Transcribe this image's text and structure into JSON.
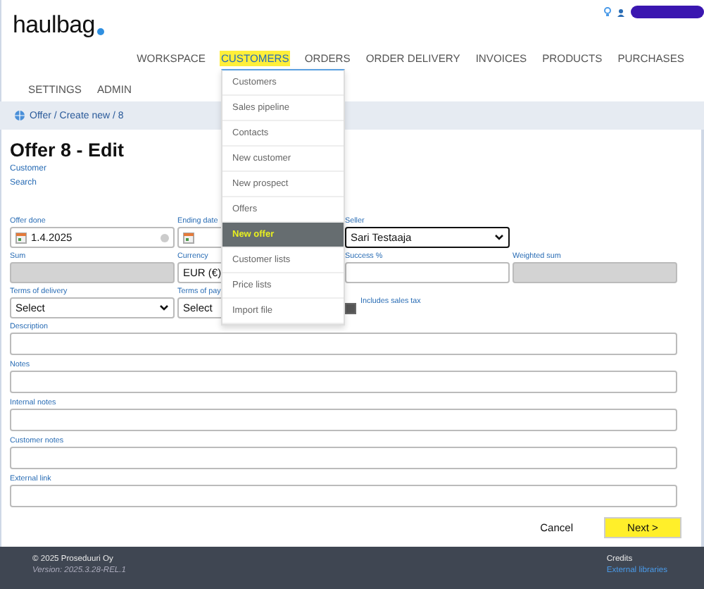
{
  "logo": {
    "text": "haulbag"
  },
  "nav": [
    {
      "label": "WORKSPACE",
      "selected": false
    },
    {
      "label": "CUSTOMERS",
      "selected": true
    },
    {
      "label": "ORDERS",
      "selected": false
    },
    {
      "label": "ORDER DELIVERY",
      "selected": false
    },
    {
      "label": "INVOICES",
      "selected": false
    },
    {
      "label": "PRODUCTS",
      "selected": false
    },
    {
      "label": "PURCHASES",
      "selected": false
    },
    {
      "label": "SETTINGS",
      "selected": false
    },
    {
      "label": "ADMIN",
      "selected": false
    }
  ],
  "menu": [
    {
      "label": "Customers",
      "selected": false
    },
    {
      "label": "Sales pipeline",
      "selected": false
    },
    {
      "label": "Contacts",
      "selected": false
    },
    {
      "label": "New customer",
      "selected": false
    },
    {
      "label": "New prospect",
      "selected": false
    },
    {
      "label": "Offers",
      "selected": false
    },
    {
      "label": "New offer",
      "selected": true
    },
    {
      "label": "Customer lists",
      "selected": false
    },
    {
      "label": "Price lists",
      "selected": false
    },
    {
      "label": "Import file",
      "selected": false
    }
  ],
  "breadcrumb": "Offer / Create new / 8",
  "title": "Offer 8 - Edit",
  "customer": {
    "label": "Customer",
    "link": "Search"
  },
  "fields": [
    {
      "kind": "date",
      "label": "Offer done",
      "value": "1.4.2025"
    },
    {
      "kind": "date",
      "label": "Ending date"
    },
    {
      "kind": "select",
      "label": "Seller",
      "value": "Sari Testaaja"
    },
    {
      "kind": "empty"
    },
    {
      "kind": "readonly",
      "label": "Sum"
    },
    {
      "kind": "text",
      "label": "Currency",
      "value": "EUR (€)"
    },
    {
      "kind": "text",
      "label": "Success %"
    },
    {
      "kind": "readonly",
      "label": "Weighted sum"
    },
    {
      "kind": "select",
      "label": "Terms of delivery",
      "value": "Select"
    },
    {
      "kind": "select",
      "label": "Terms of pay",
      "value": "Select"
    },
    {
      "kind": "checkbox",
      "label": "Includes sales tax",
      "checked": true
    },
    {
      "kind": "empty"
    },
    {
      "kind": "wide",
      "label": "Description"
    },
    {
      "kind": "wide",
      "label": "Notes"
    },
    {
      "kind": "wide",
      "label": "Internal notes"
    },
    {
      "kind": "wide",
      "label": "Customer notes"
    },
    {
      "kind": "wide",
      "label": "External link"
    }
  ],
  "buttons": [
    {
      "label": "Cancel",
      "kind": "plain",
      "highlighted": false
    },
    {
      "label": "Next >",
      "kind": "primary",
      "highlighted": true
    }
  ],
  "footer": {
    "copyright": "© 2025 Proseduuri Oy",
    "version": "Version: 2025.3.28-REL.1",
    "credits": "Credits",
    "link": "External libraries"
  }
}
